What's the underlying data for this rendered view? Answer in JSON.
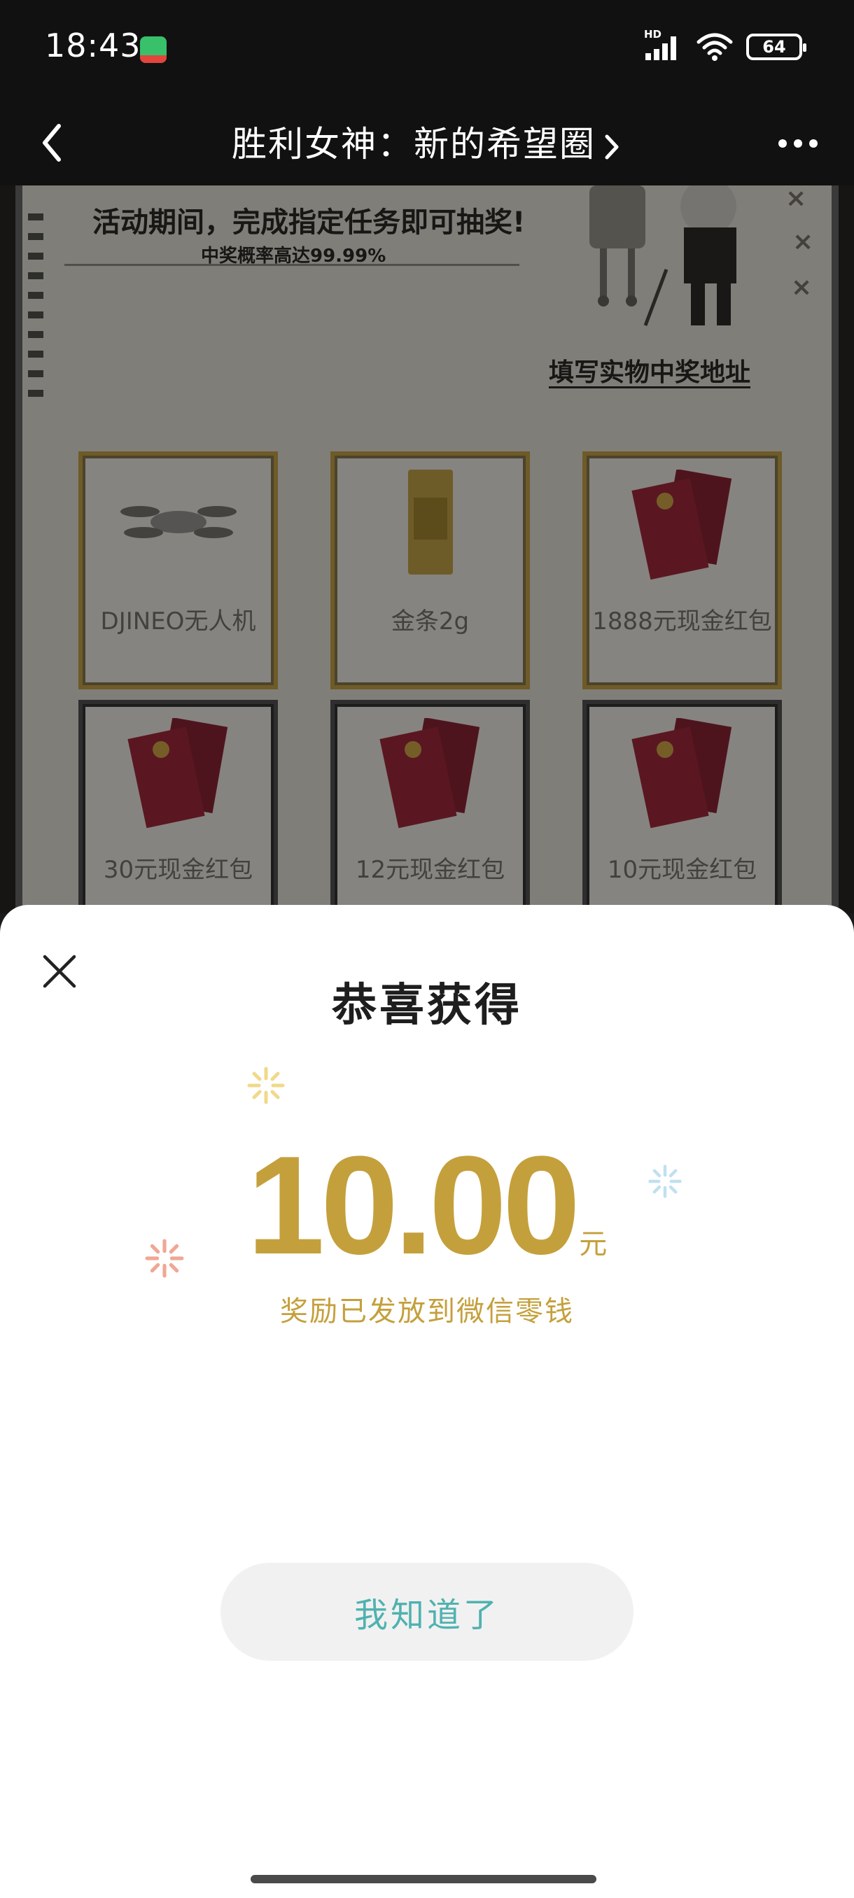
{
  "status_bar": {
    "time": "18:43",
    "network_label": "HD",
    "battery": "64",
    "icons": [
      "app-notification-icon",
      "signal-icon",
      "wifi-icon",
      "battery-icon"
    ]
  },
  "nav": {
    "title": "胜利女神：新的希望圈",
    "icons": [
      "back-chevron-icon",
      "chevron-right-icon",
      "more-dots-icon"
    ]
  },
  "event": {
    "headline": "活动期间，完成指定任务即可抽奖!",
    "subline": "中奖概率高达99.99%",
    "address_link": "填写实物中奖地址",
    "prizes": [
      {
        "label": "DJINEO无人机",
        "icon": "drone-icon"
      },
      {
        "label": "金条2g",
        "icon": "gold-bar-icon"
      },
      {
        "label": "1888元现金红包",
        "icon": "red-envelope-icon"
      },
      {
        "label": "30元现金红包",
        "icon": "red-envelope-icon"
      },
      {
        "label": "12元现金红包",
        "icon": "red-envelope-icon"
      },
      {
        "label": "10元现金红包",
        "icon": "red-envelope-icon"
      }
    ]
  },
  "sheet": {
    "title": "恭喜获得",
    "amount": "10.00",
    "unit": "元",
    "note": "奖励已发放到微信零钱",
    "button_label": "我知道了",
    "colors": {
      "gold": "#c4a03c",
      "button_text": "#4fb2b0",
      "button_bg": "#f1f1f1"
    }
  }
}
